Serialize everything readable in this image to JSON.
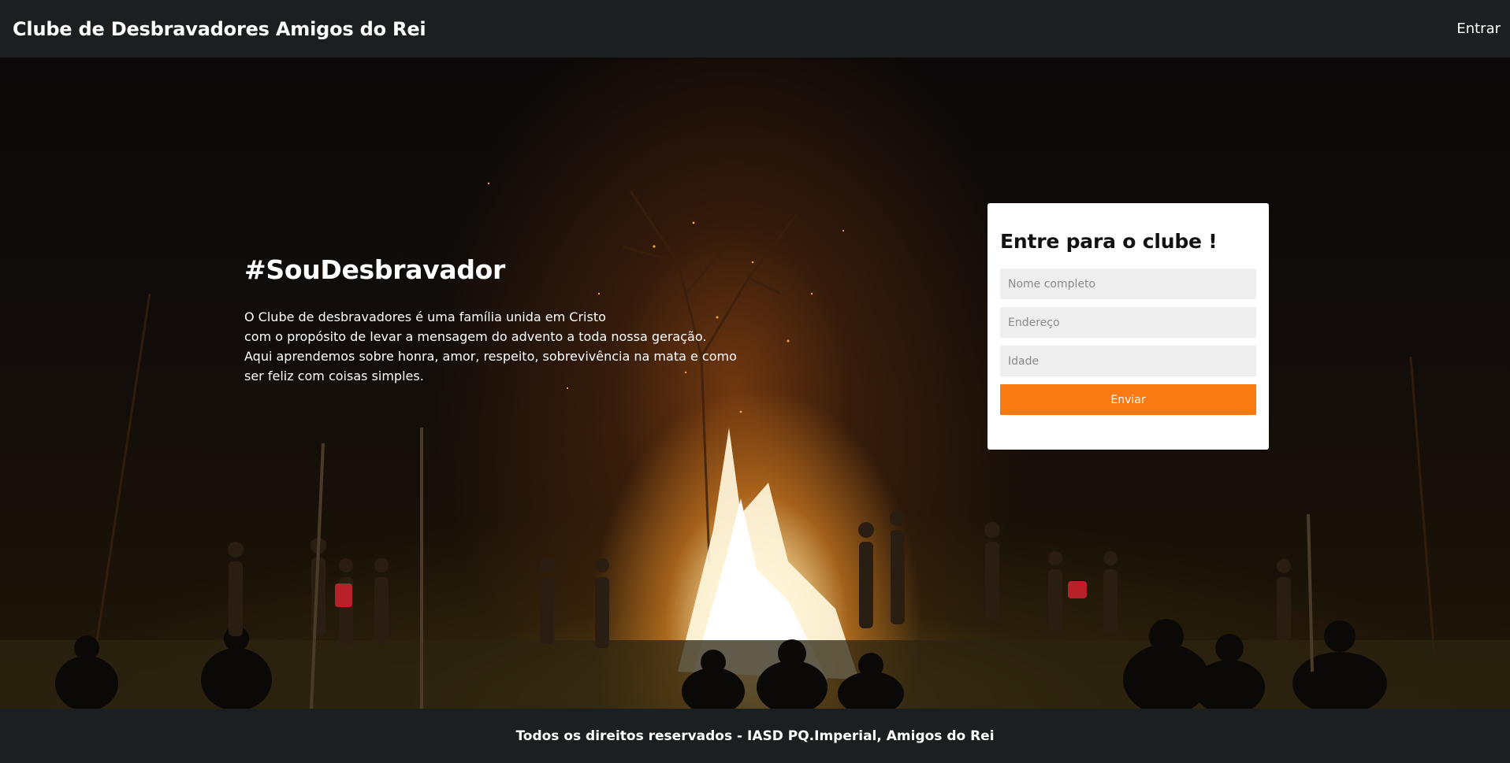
{
  "header": {
    "title": "Clube de Desbravadores Amigos do Rei",
    "login_label": "Entrar"
  },
  "hero": {
    "heading": "#SouDesbravador",
    "paragraph_lines": [
      "O Clube de desbravadores é uma família unida em Cristo",
      "com o propósito de levar a mensagem do advento a toda nossa geração.",
      "Aqui aprendemos sobre honra, amor, respeito, sobrevivência na mata e como",
      "ser feliz com coisas simples."
    ]
  },
  "signup": {
    "title": "Entre para o clube !",
    "fields": [
      {
        "placeholder": "Nome completo"
      },
      {
        "placeholder": "Endereço"
      },
      {
        "placeholder": "Idade"
      }
    ],
    "submit_label": "Enviar"
  },
  "footer": {
    "text": "Todos os direitos reservados - IASD PQ.Imperial, Amigos do Rei"
  },
  "colors": {
    "bar_background": "#1c1f20",
    "accent": "#f97a13",
    "input_background": "#eeeeee"
  }
}
